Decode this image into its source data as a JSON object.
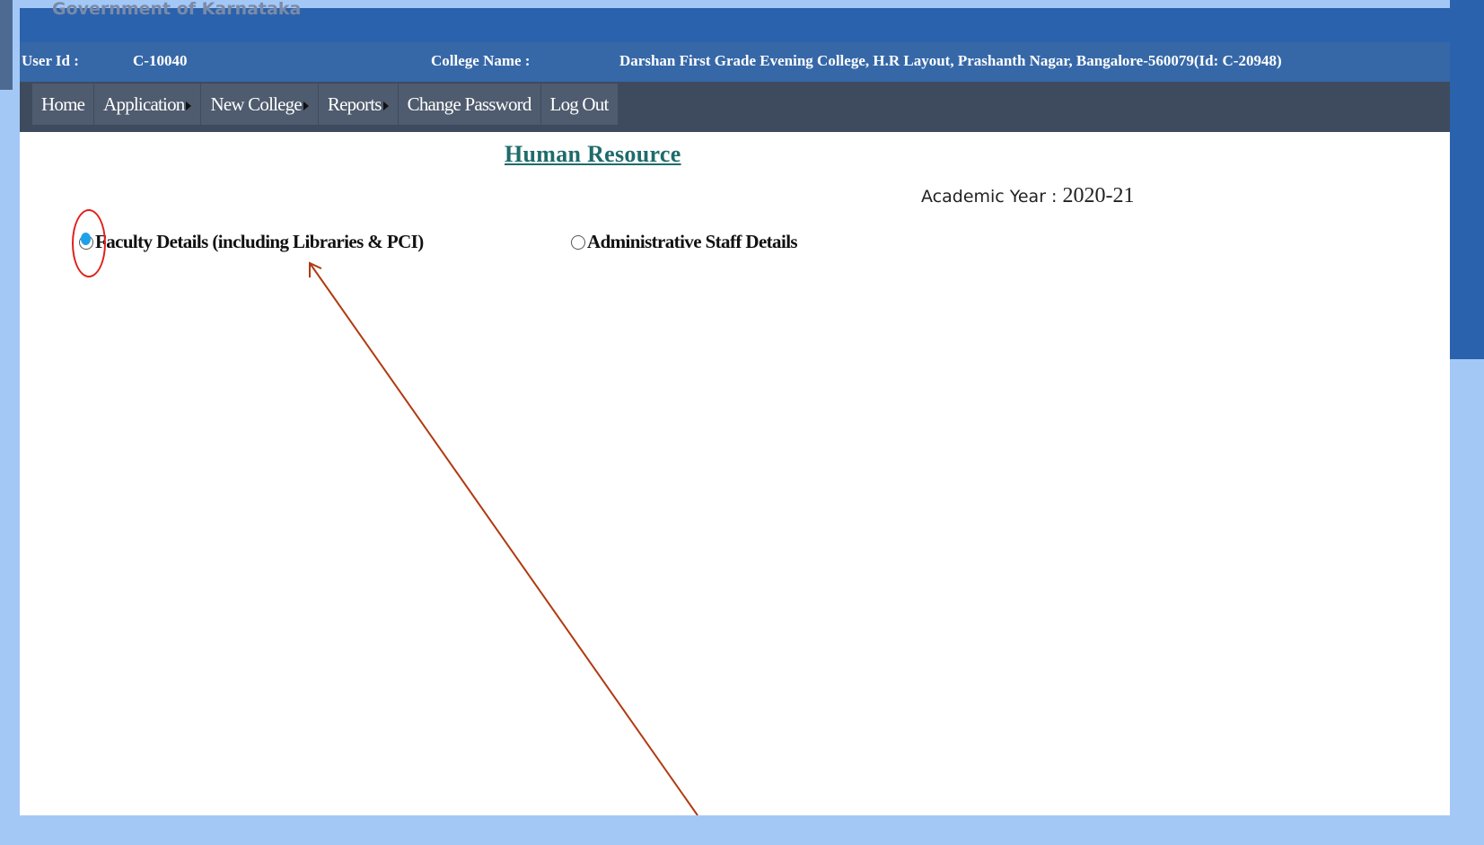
{
  "header": {
    "gov_title": "Government of Karnataka"
  },
  "info_bar": {
    "user_id_label": "User Id :",
    "user_id_value": "C-10040",
    "college_name_label": "College Name :",
    "college_name_value": "Darshan First Grade Evening College, H.R Layout, Prashanth Nagar, Bangalore-560079(Id: C-20948)"
  },
  "nav": {
    "items": [
      {
        "label": "Home"
      },
      {
        "label": "Application"
      },
      {
        "label": "New College"
      },
      {
        "label": "Reports"
      },
      {
        "label": "Change Password"
      },
      {
        "label": "Log Out"
      }
    ]
  },
  "main": {
    "title": "Human Resource",
    "academic_year_label": "Academic Year :",
    "academic_year_value": "2020-21",
    "options": [
      {
        "label": "Faculty Details (including Libraries & PCI)",
        "checked": true
      },
      {
        "label": "Administrative Staff Details",
        "checked": false
      }
    ]
  },
  "colors": {
    "header_blue": "#2b62ad",
    "nav_dark": "#3e4b5e",
    "title_teal": "#1f6b6b",
    "annotation_red": "#e0201a",
    "arrow_brown": "#b03a10"
  }
}
